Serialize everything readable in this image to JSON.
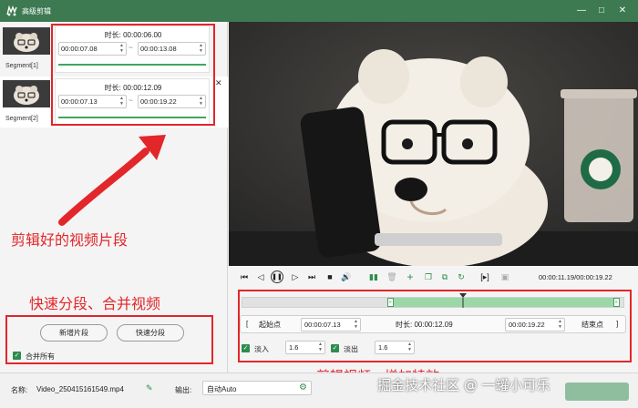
{
  "window": {
    "title": "高级剪辑",
    "minimize": "—",
    "maximize": "□",
    "close": "✕"
  },
  "segments": [
    {
      "label": "Segment[1]",
      "duration_label": "时长: 00:00:06.00",
      "start": "00:00:07.08",
      "end": "00:00:13.08"
    },
    {
      "label": "Segment[2]",
      "duration_label": "时长: 00:00:12.09",
      "start": "00:00:07.13",
      "end": "00:00:19.22"
    }
  ],
  "left_panel": {
    "dash": "~",
    "close_glyph": "✕",
    "add_segment": "新增片段",
    "quick_split": "快速分段",
    "merge_all": "合并所有"
  },
  "annotations": {
    "clips": "剪辑好的视频片段",
    "split_merge": "快速分段、合并视频",
    "effects": "剪辑视频、增加特效"
  },
  "player": {
    "time_display": "00:00:11.19/00:00:19.22",
    "timeline_selection": [
      0.38,
      0.99
    ],
    "playhead": 0.58
  },
  "edit_row": {
    "start_button": "起始点",
    "start": "00:00:07.13",
    "duration_label": "时长: 00:00:12.09",
    "end": "00:00:19.22",
    "end_button": "结束点"
  },
  "fade": {
    "fade_in_label": "淡入",
    "fade_in_value": "1.6",
    "fade_out_label": "淡出",
    "fade_out_value": "1.6"
  },
  "bottom": {
    "name_label": "名称:",
    "name_value": "Video_250415161549.mp4",
    "output_label": "输出:",
    "output_value": "自动Auto",
    "watermark": "掘金技术社区 @ 一罐小可乐"
  },
  "colors": {
    "titlebar": "#3d7a52",
    "accent": "#2e8c4e",
    "annotation": "#e3262a",
    "selection": "#9bd7a7"
  }
}
